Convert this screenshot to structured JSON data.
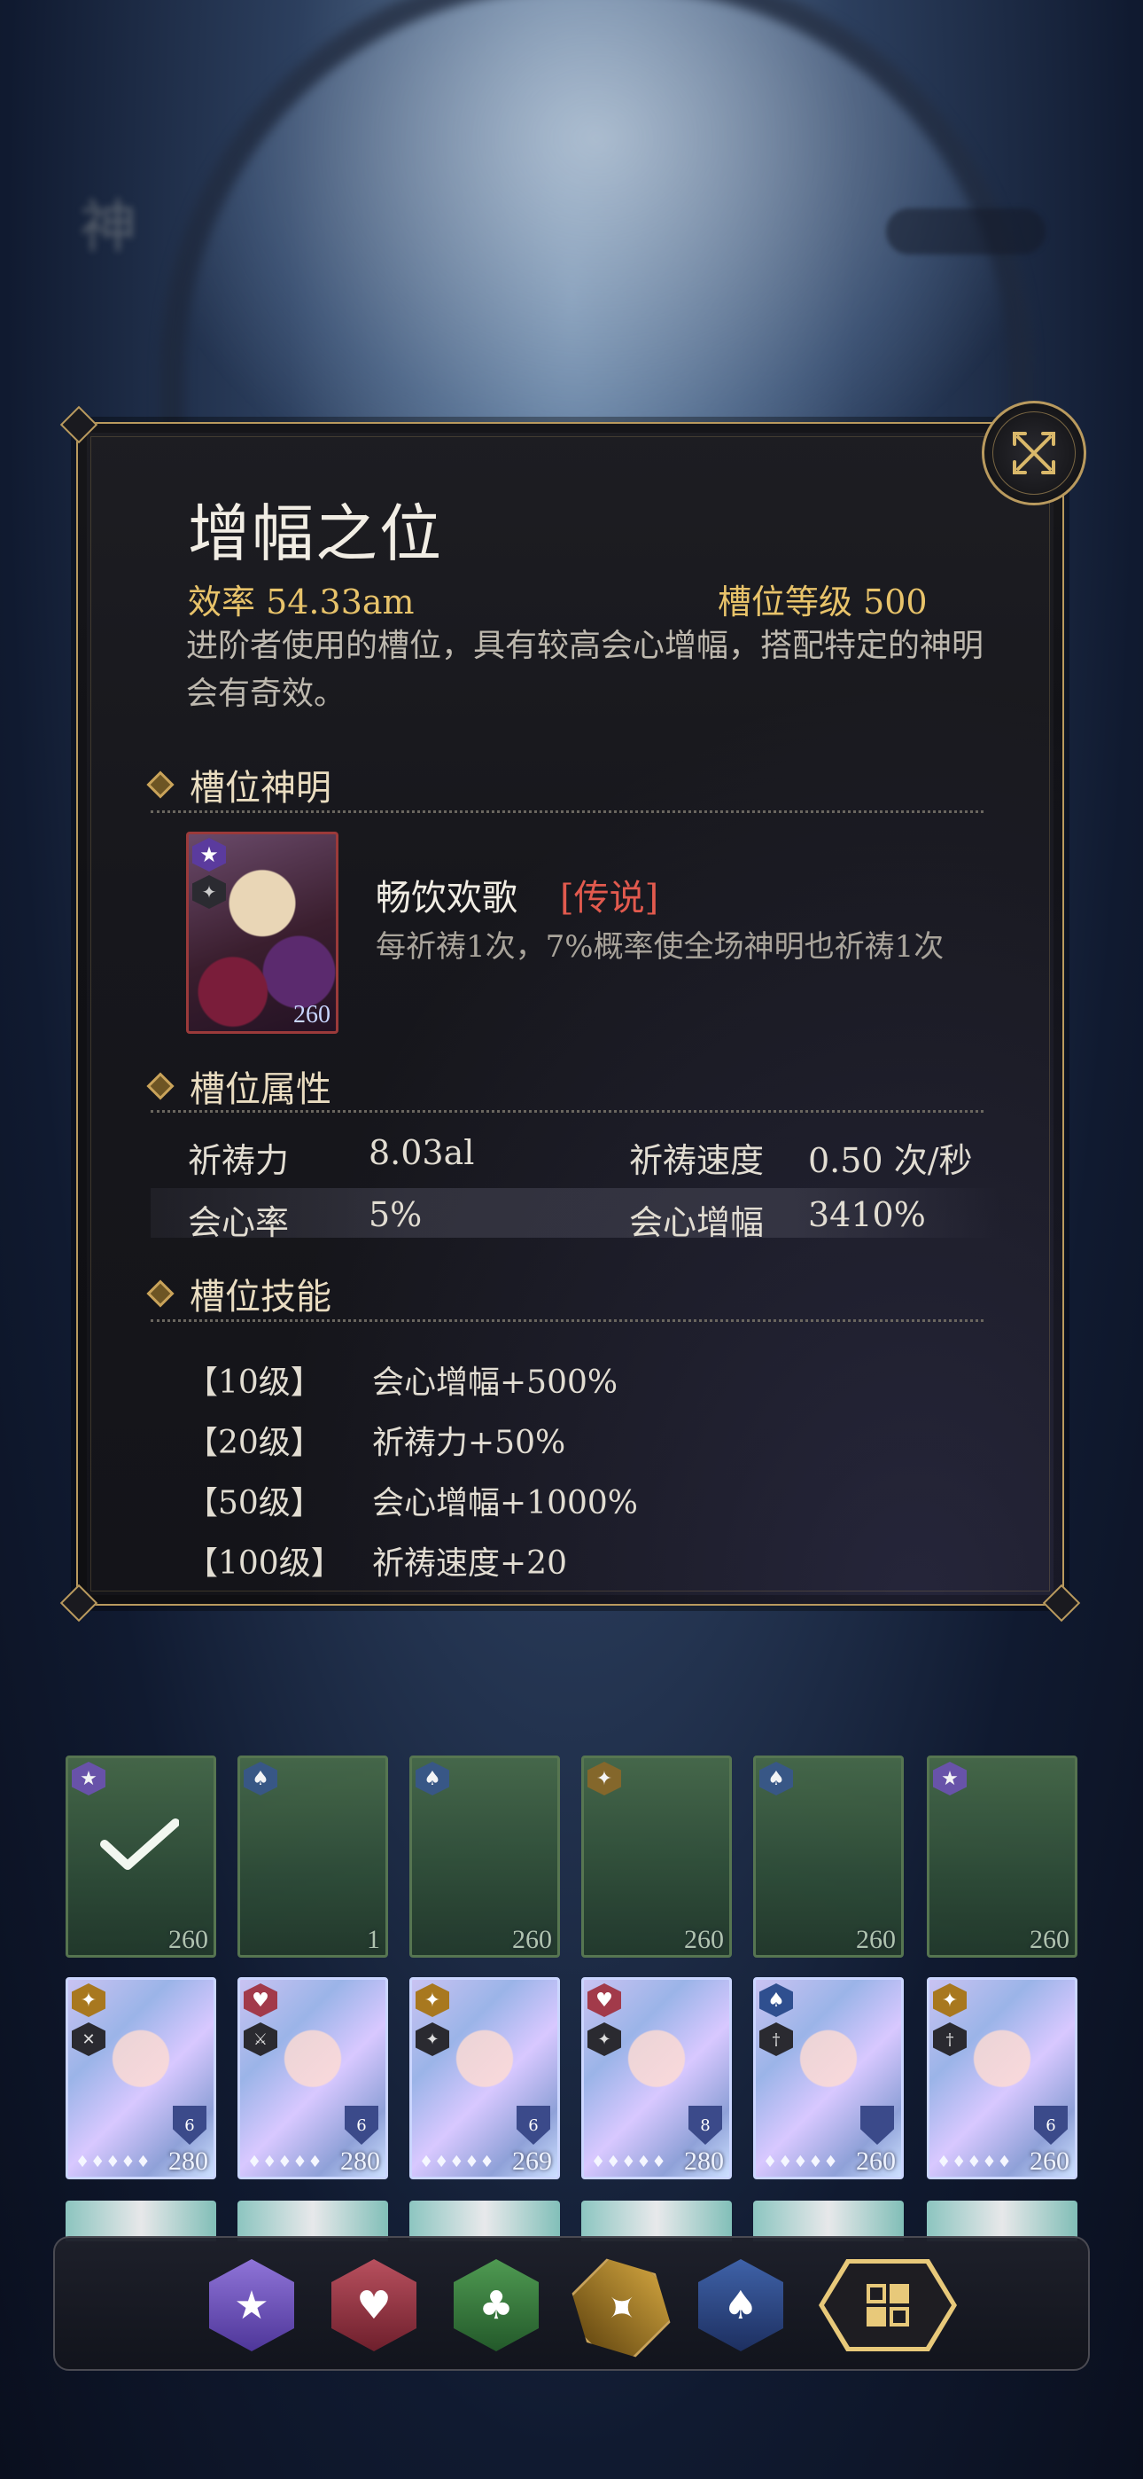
{
  "background": {
    "title_blurred": "神"
  },
  "panel": {
    "title": "增幅之位",
    "efficiency": "效率 54.33am",
    "slot_level": "槽位等级 500",
    "description": "进阶者使用的槽位，具有较高会心增幅，搭配特定的神明会有奇效。"
  },
  "sections": {
    "god": "槽位神明",
    "attributes": "槽位属性",
    "skills": "槽位技能"
  },
  "god": {
    "name": "畅饮欢歌",
    "rarity": "[传说]",
    "effect": "每祈祷1次，7%概率使全场神明也祈祷1次",
    "level": "260"
  },
  "attributes": [
    {
      "label": "祈祷力",
      "value": "8.03al",
      "label2": "祈祷速度",
      "value2": "0.50 次/秒"
    },
    {
      "label": "会心率",
      "value": "5%",
      "label2": "会心增幅",
      "value2": "3410%"
    }
  ],
  "skills": [
    {
      "level": "【10级】",
      "effect": "会心增幅+500%"
    },
    {
      "level": "【20级】",
      "effect": "祈祷力+50%"
    },
    {
      "level": "【50级】",
      "effect": "会心增幅+1000%"
    },
    {
      "level": "【100级】",
      "effect": "祈祷速度+20"
    }
  ],
  "card_grid": {
    "row1_levels": [
      "260",
      "1",
      "260",
      "260",
      "260",
      "260"
    ],
    "row2_levels": [
      "280",
      "280",
      "269",
      "280",
      "260",
      "260"
    ],
    "row2_shield_numbers": [
      "6",
      "6",
      "6",
      "8",
      "",
      "6"
    ]
  },
  "colors": {
    "accent_gold": "#e8c36a",
    "rarity_red": "#e25a4e",
    "panel_border": "#b99a5e"
  },
  "icons": {
    "close": "close-cross-icon",
    "suits": [
      "star-suit-icon",
      "heart-suit-icon",
      "club-suit-icon",
      "diamond-suit-icon",
      "spade-suit-icon",
      "all-suits-icon"
    ]
  }
}
